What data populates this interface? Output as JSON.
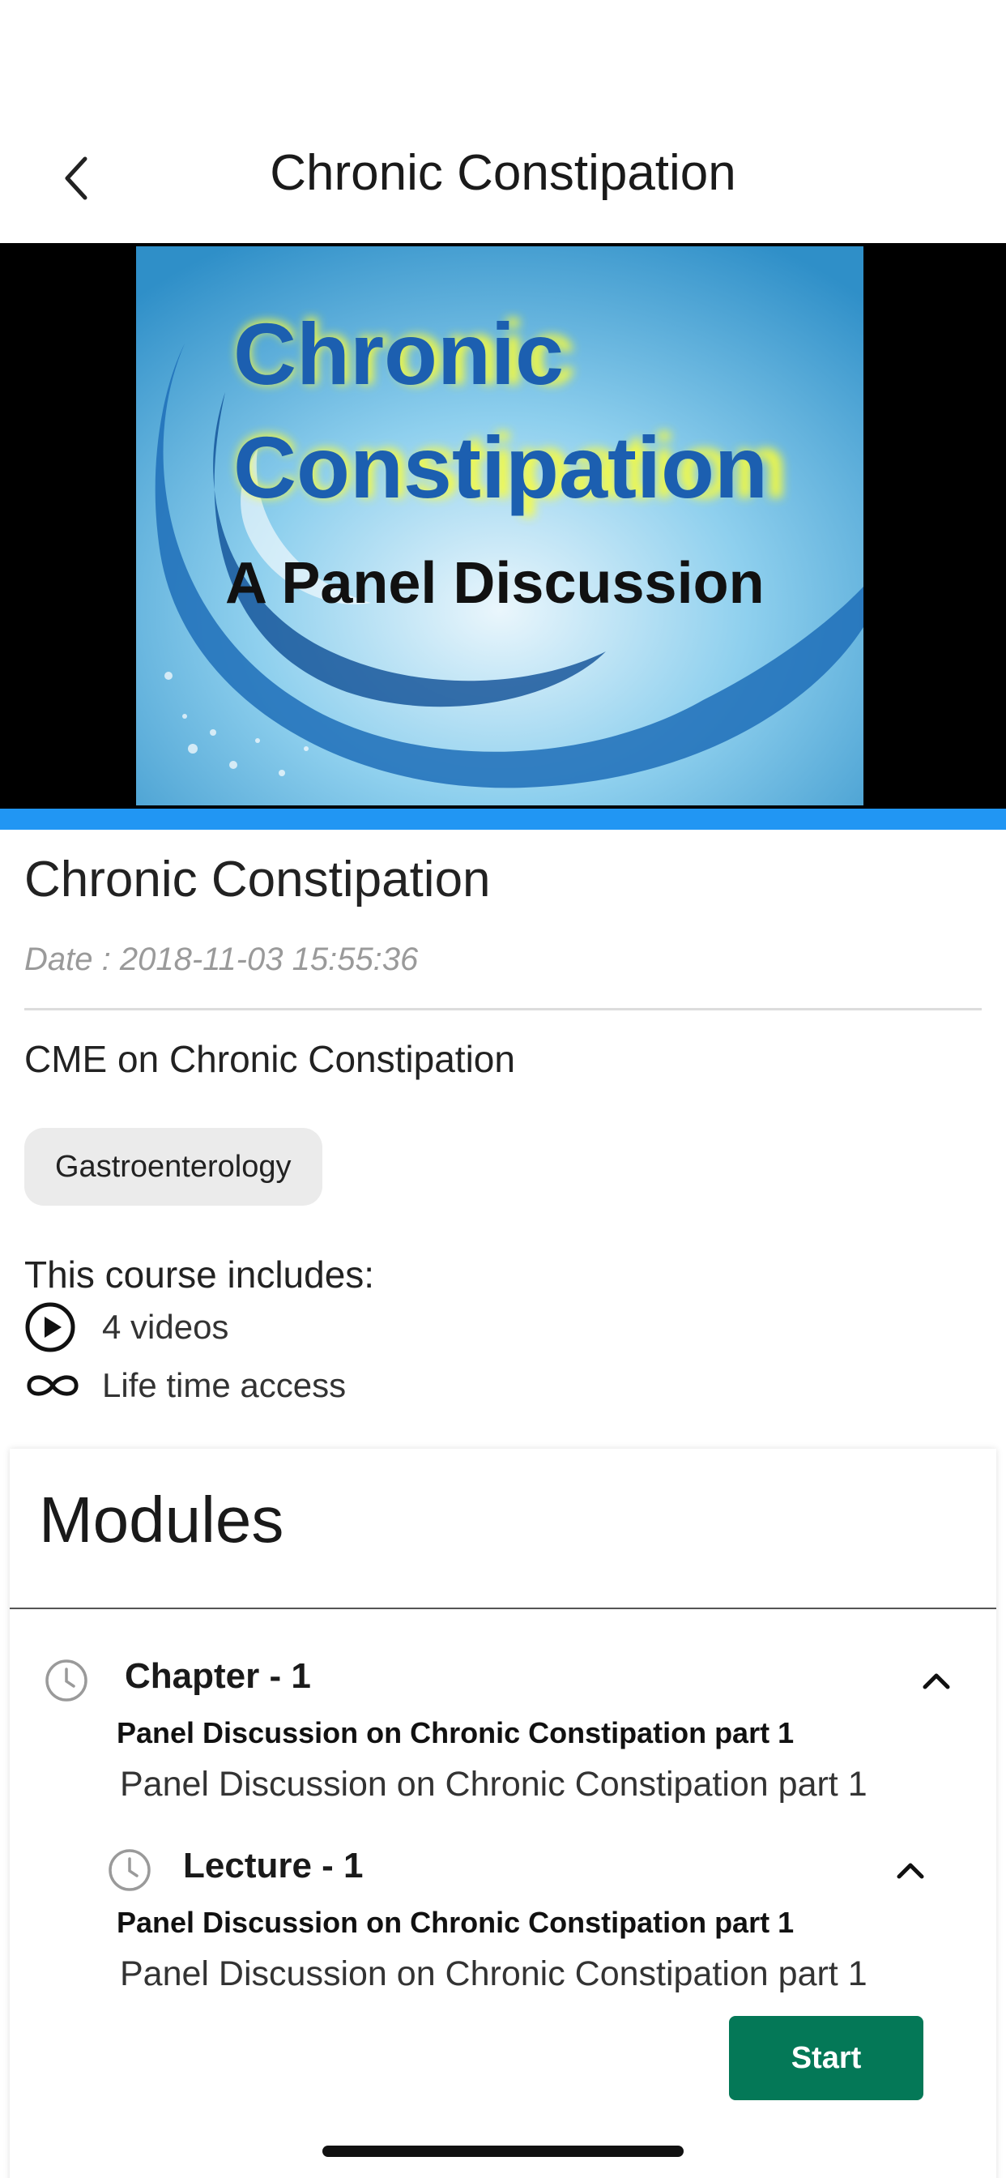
{
  "header": {
    "title": "Chronic Constipation"
  },
  "video": {
    "thumb_line1": "Chronic",
    "thumb_line2": "Constipation",
    "thumb_line3": "A Panel Discussion"
  },
  "course": {
    "title": "Chronic Constipation",
    "date": "Date : 2018-11-03 15:55:36",
    "description": "CME on Chronic Constipation",
    "tag": "Gastroenterology",
    "includes_title": "This course includes:",
    "includes": [
      {
        "icon": "play-circle-icon",
        "text": "4 videos"
      },
      {
        "icon": "infinity-icon",
        "text": "Life time access"
      }
    ]
  },
  "modules": {
    "title": "Modules",
    "chapter": {
      "label": "Chapter - 1",
      "title": "Panel Discussion on Chronic Constipation part 1",
      "subtitle": "Panel Discussion on Chronic Constipation part 1"
    },
    "lecture": {
      "label": "Lecture - 1",
      "title": "Panel Discussion on Chronic Constipation part 1",
      "subtitle": "Panel Discussion on Chronic Constipation part 1"
    },
    "start_label": "Start"
  },
  "colors": {
    "accent_blue": "#2196f3",
    "start_green": "#047857",
    "tag_bg": "#ebebeb"
  }
}
